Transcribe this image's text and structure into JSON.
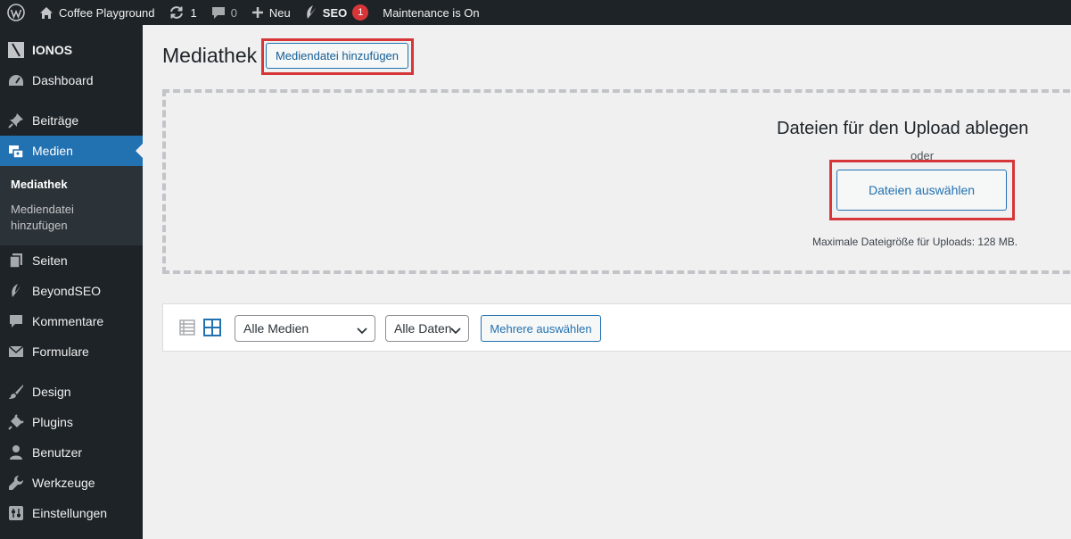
{
  "admin_bar": {
    "site_name": "Coffee Playground",
    "updates_count": "1",
    "comments_count": "0",
    "new_label": "Neu",
    "seo_label": "SEO",
    "seo_badge": "1",
    "maintenance_label": "Maintenance is On"
  },
  "sidebar": {
    "items": [
      {
        "label": "IONOS",
        "icon": "ionos-logo-icon"
      },
      {
        "label": "Dashboard",
        "icon": "dashboard-icon"
      },
      {
        "label": "Beiträge",
        "icon": "pin-icon"
      },
      {
        "label": "Medien",
        "icon": "media-icon",
        "current": true
      },
      {
        "label": "Seiten",
        "icon": "pages-icon"
      },
      {
        "label": "BeyondSEO",
        "icon": "beyondseo-icon"
      },
      {
        "label": "Kommentare",
        "icon": "comment-icon"
      },
      {
        "label": "Formulare",
        "icon": "mail-icon"
      },
      {
        "label": "Design",
        "icon": "brush-icon"
      },
      {
        "label": "Plugins",
        "icon": "plugin-icon"
      },
      {
        "label": "Benutzer",
        "icon": "user-icon"
      },
      {
        "label": "Werkzeuge",
        "icon": "wrench-icon"
      },
      {
        "label": "Einstellungen",
        "icon": "settings-icon"
      }
    ],
    "submenu": [
      {
        "label": "Mediathek",
        "current": true
      },
      {
        "label": "Mediendatei hinzufügen"
      }
    ]
  },
  "main": {
    "title": "Mediathek",
    "add_button": "Mediendatei hinzufügen",
    "dropzone": {
      "title": "Dateien für den Upload ablegen",
      "or": "oder",
      "select_button": "Dateien auswählen",
      "max_size": "Maximale Dateigröße für Uploads: 128 MB."
    },
    "toolbar": {
      "filter_media": "Alle Medien",
      "filter_dates": "Alle Daten",
      "bulk_select": "Mehrere auswählen"
    }
  },
  "colors": {
    "admin_bg": "#1d2327",
    "accent": "#2271b1",
    "highlight": "#d63638"
  }
}
